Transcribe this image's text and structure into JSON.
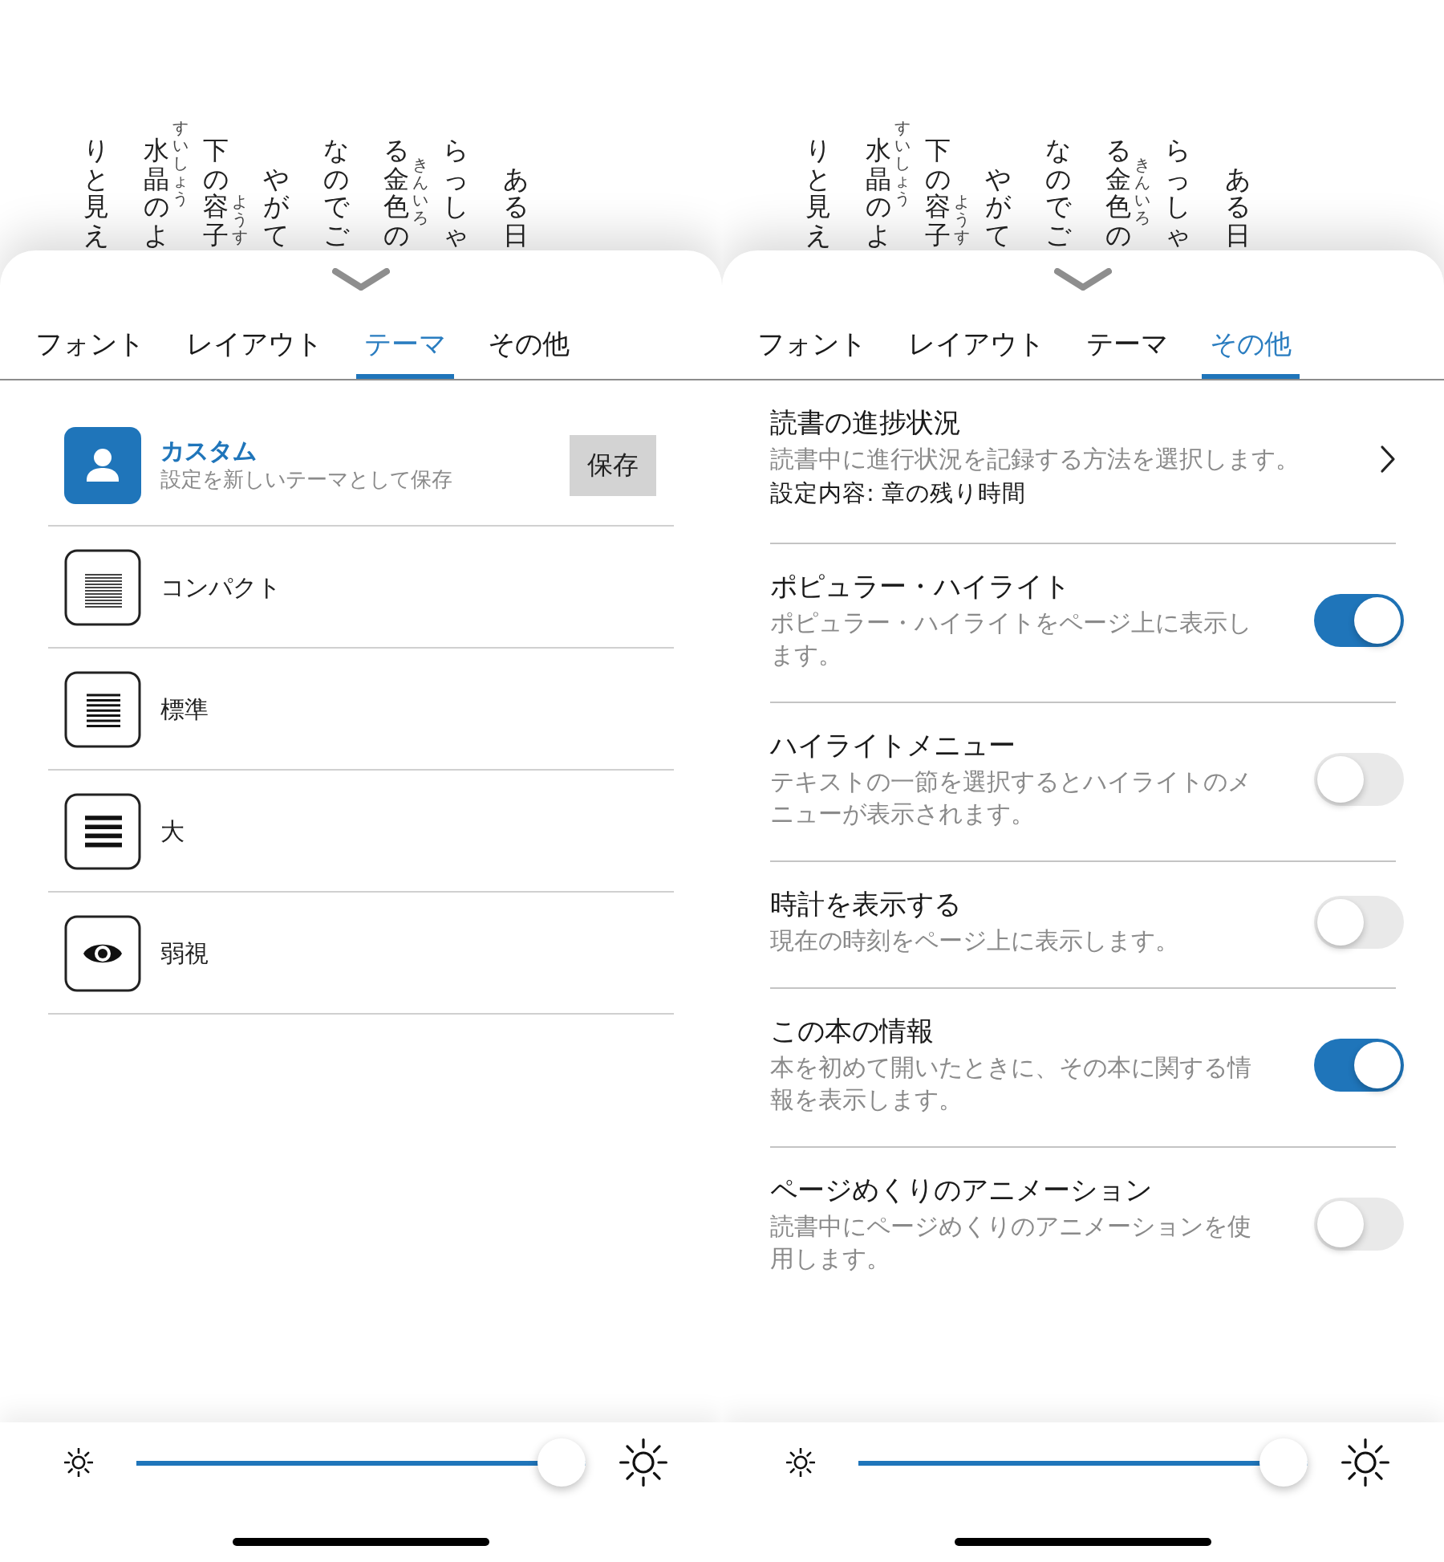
{
  "screens": [
    {
      "book_text": {
        "columns": [
          {
            "parts": [
              {
                "text": "りと見え"
              }
            ],
            "indent": false
          },
          {
            "parts": [
              {
                "text": "水晶",
                "ruby": "すいしょう"
              },
              {
                "text": "のよ"
              }
            ],
            "indent": false
          },
          {
            "parts": [
              {
                "text": "下の"
              },
              {
                "text": "容子",
                "ruby": "ようす"
              }
            ],
            "indent": false
          },
          {
            "parts": [
              {
                "text": "やがて"
              }
            ],
            "indent": true
          },
          {
            "parts": [
              {
                "text": "なのでご"
              }
            ],
            "indent": false
          },
          {
            "parts": [
              {
                "text": "る"
              },
              {
                "text": "金色",
                "ruby": "きんいろ"
              },
              {
                "text": "の"
              }
            ],
            "indent": false
          },
          {
            "parts": [
              {
                "text": "らっしゃ"
              }
            ],
            "indent": false
          },
          {
            "parts": [
              {
                "text": "ある日"
              }
            ],
            "indent": true
          }
        ]
      },
      "tabs": [
        {
          "label": "フォント",
          "selected": false
        },
        {
          "label": "レイアウト",
          "selected": false
        },
        {
          "label": "テーマ",
          "selected": true
        },
        {
          "label": "その他",
          "selected": false
        }
      ],
      "panel": {
        "kind": "themes",
        "items": [
          {
            "kind": "custom",
            "title": "カスタム",
            "description": "設定を新しいテーマとして保存",
            "button": "保存"
          },
          {
            "kind": "compact",
            "title": "コンパクト"
          },
          {
            "kind": "standard",
            "title": "標準"
          },
          {
            "kind": "large",
            "title": "大"
          },
          {
            "kind": "low_vision",
            "title": "弱視"
          }
        ]
      },
      "brightness": {
        "level": 1
      }
    },
    {
      "book_text": {
        "columns": [
          {
            "parts": [
              {
                "text": "りと見え"
              }
            ],
            "indent": false
          },
          {
            "parts": [
              {
                "text": "水晶",
                "ruby": "すいしょう"
              },
              {
                "text": "のよ"
              }
            ],
            "indent": false
          },
          {
            "parts": [
              {
                "text": "下の"
              },
              {
                "text": "容子",
                "ruby": "ようす"
              }
            ],
            "indent": false
          },
          {
            "parts": [
              {
                "text": "やがて"
              }
            ],
            "indent": true
          },
          {
            "parts": [
              {
                "text": "なのでご"
              }
            ],
            "indent": false
          },
          {
            "parts": [
              {
                "text": "る"
              },
              {
                "text": "金色",
                "ruby": "きんいろ"
              },
              {
                "text": "の"
              }
            ],
            "indent": false
          },
          {
            "parts": [
              {
                "text": "らっしゃ"
              }
            ],
            "indent": false
          },
          {
            "parts": [
              {
                "text": "ある日"
              }
            ],
            "indent": true
          }
        ]
      },
      "tabs": [
        {
          "label": "フォント",
          "selected": false
        },
        {
          "label": "レイアウト",
          "selected": false
        },
        {
          "label": "テーマ",
          "selected": false
        },
        {
          "label": "その他",
          "selected": true
        }
      ],
      "panel": {
        "kind": "settings",
        "items": [
          {
            "kind": "link",
            "title": "読書の進捗状況",
            "description": "読書中に進行状況を記録する方法を選択します。",
            "value": "設定内容: 章の残り時間"
          },
          {
            "kind": "toggle",
            "title": "ポピュラー・ハイライト",
            "description": "ポピュラー・ハイライトをページ上に表示します。",
            "on": true
          },
          {
            "kind": "toggle",
            "title": "ハイライトメニュー",
            "description": "テキストの一節を選択するとハイライトのメニューが表示されます。",
            "on": false
          },
          {
            "kind": "toggle",
            "title": "時計を表示する",
            "description": "現在の時刻をページ上に表示します。",
            "on": false
          },
          {
            "kind": "toggle",
            "title": "この本の情報",
            "description": "本を初めて開いたときに、その本に関する情報を表示します。",
            "on": true
          },
          {
            "kind": "toggle",
            "title": "ページめくりのアニメーション",
            "description": "読書中にページめくりのアニメーションを使用します。",
            "on": false
          }
        ]
      },
      "brightness": {
        "level": 1
      }
    }
  ]
}
